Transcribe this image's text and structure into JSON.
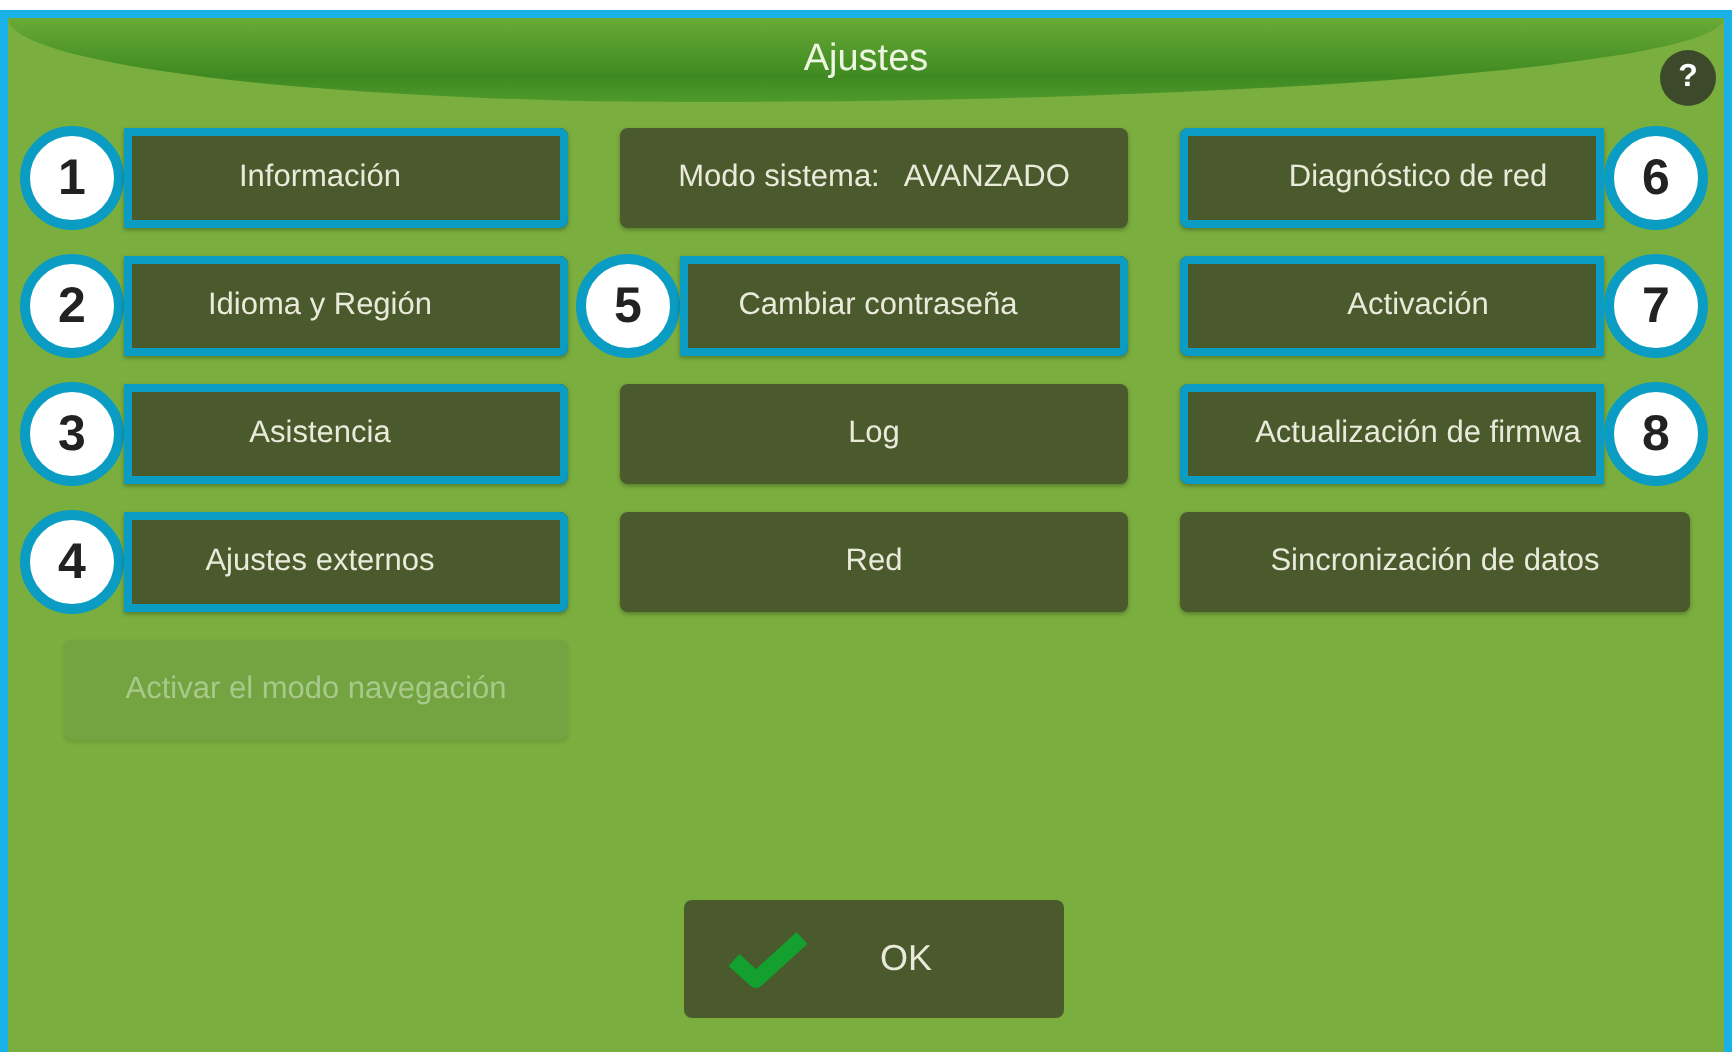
{
  "window": {
    "title": "Ajustes",
    "help": "?"
  },
  "rows": [
    [
      {
        "label": "Información",
        "disabled": false,
        "highlighted": true,
        "callout": {
          "number": "1",
          "kind": "left"
        }
      },
      {
        "label": "Modo sistema:   AVANZADO",
        "disabled": false,
        "highlighted": false
      },
      {
        "label": "Diagnóstico de red",
        "disabled": false,
        "highlighted": true,
        "callout": {
          "number": "6",
          "kind": "right"
        }
      }
    ],
    [
      {
        "label": "Idioma y Región",
        "disabled": false,
        "highlighted": true,
        "callout": {
          "number": "2",
          "kind": "left"
        }
      },
      {
        "label": "Cambiar contraseña",
        "disabled": false,
        "highlighted": true,
        "callout": {
          "number": "5",
          "kind": "left"
        }
      },
      {
        "label": "Activación",
        "disabled": false,
        "highlighted": true,
        "callout": {
          "number": "7",
          "kind": "right"
        }
      }
    ],
    [
      {
        "label": "Asistencia",
        "disabled": false,
        "highlighted": true,
        "callout": {
          "number": "3",
          "kind": "left"
        }
      },
      {
        "label": "Log",
        "disabled": false,
        "highlighted": false
      },
      {
        "label": "Actualización de firmwa",
        "disabled": false,
        "highlighted": true,
        "callout": {
          "number": "8",
          "kind": "right"
        }
      }
    ],
    [
      {
        "label": "Ajustes externos",
        "disabled": false,
        "highlighted": true,
        "callout": {
          "number": "4",
          "kind": "left"
        }
      },
      {
        "label": "Red",
        "disabled": false,
        "highlighted": false
      },
      {
        "label": "Sincronización de datos",
        "disabled": false,
        "highlighted": false
      }
    ],
    [
      {
        "label": "Activar el modo navegación",
        "disabled": true,
        "highlighted": false
      }
    ]
  ],
  "ok_button": {
    "label": "OK"
  }
}
